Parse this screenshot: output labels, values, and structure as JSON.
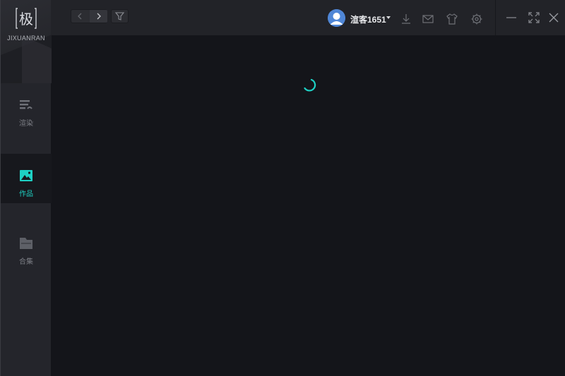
{
  "brand": {
    "logo_char": "极",
    "logo_text": "JIXUANRAN"
  },
  "sidebar": {
    "items": [
      {
        "label": "渲染",
        "icon": "render-list-icon",
        "active": false
      },
      {
        "label": "作品",
        "icon": "image-icon",
        "active": true
      },
      {
        "label": "合集",
        "icon": "folder-icon",
        "active": false
      }
    ]
  },
  "header": {
    "user": {
      "name": "渲客1651",
      "avatar_icon": "user-avatar-icon",
      "menu_icon": "caret-down-icon"
    },
    "icons": [
      "download-icon",
      "mail-icon",
      "tshirt-icon",
      "gear-icon"
    ],
    "window_controls": [
      "minimize-icon",
      "maximize-icon",
      "close-icon"
    ]
  },
  "main": {
    "loading_icon": "spinner-icon"
  },
  "colors": {
    "accent": "#1ed0c4",
    "sidebar_bg": "#24252b",
    "topbar_bg": "#222328",
    "content_bg": "#14151a"
  }
}
